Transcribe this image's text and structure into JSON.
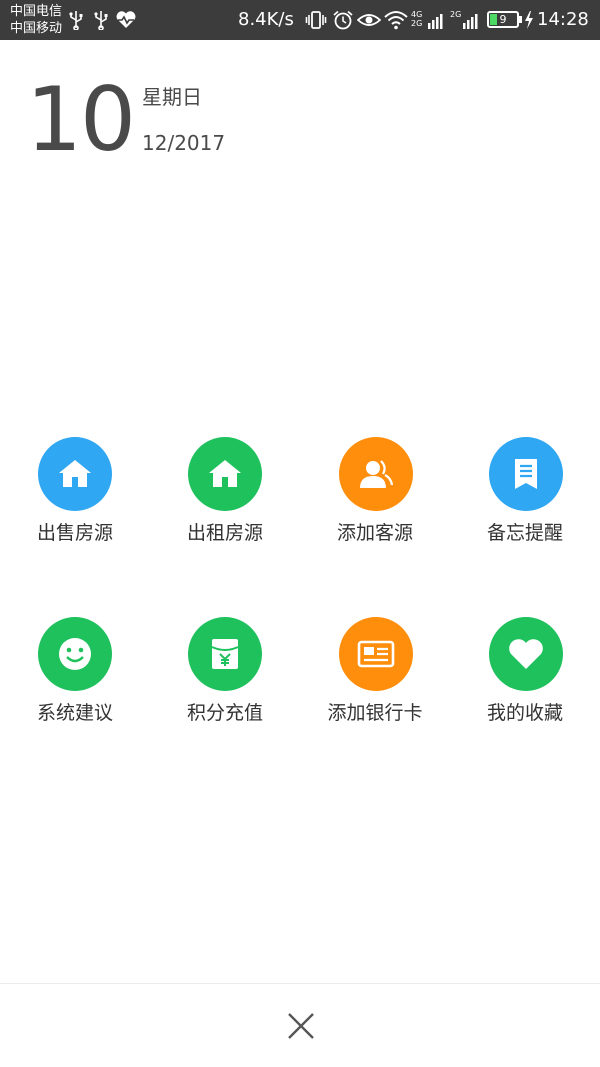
{
  "status_bar": {
    "carrier_1": "中国电信",
    "carrier_2": "中国移动",
    "net_speed": "8.4K/s",
    "battery_level": "9",
    "network_1": "4G",
    "network_2": "2G",
    "time": "14:28",
    "icons": [
      "usb-icon",
      "usb-icon",
      "heartbeat-icon",
      "vibrate-icon",
      "alarm-icon",
      "eye-icon",
      "wifi-icon",
      "signal-icon",
      "signal-icon",
      "battery-icon",
      "charging-icon"
    ]
  },
  "date": {
    "day": "10",
    "weekday": "星期日",
    "month_year": "12/2017"
  },
  "actions": [
    {
      "label": "出售房源",
      "icon": "house-icon",
      "color": "#2fa7f2"
    },
    {
      "label": "出租房源",
      "icon": "house-icon",
      "color": "#1fc15d"
    },
    {
      "label": "添加客源",
      "icon": "contact-icon",
      "color": "#ff8e0c"
    },
    {
      "label": "备忘提醒",
      "icon": "memo-icon",
      "color": "#2fa7f2"
    },
    {
      "label": "系统建议",
      "icon": "smile-icon",
      "color": "#1fc15d"
    },
    {
      "label": "积分充值",
      "icon": "yuan-icon",
      "color": "#1fc15d"
    },
    {
      "label": "添加银行卡",
      "icon": "bank-card-icon",
      "color": "#ff8e0c"
    },
    {
      "label": "我的收藏",
      "icon": "heart-icon",
      "color": "#1fc15d"
    }
  ],
  "bottom": {
    "close_icon": "close-icon"
  }
}
